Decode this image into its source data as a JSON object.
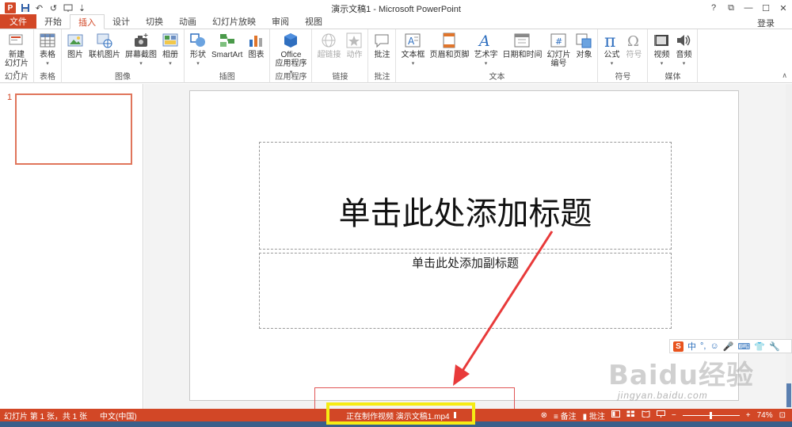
{
  "window": {
    "title": "演示文稿1 - Microsoft PowerPoint",
    "help": "?",
    "restore": "⧉",
    "minimize": "—",
    "maximize": "☐",
    "close": "✕"
  },
  "qat": {
    "logo": "P",
    "save": "💾",
    "undo": "↶",
    "redo": "↺",
    "present": "🖵",
    "more": "⇣"
  },
  "tabs": [
    "文件",
    "开始",
    "插入",
    "设计",
    "切换",
    "动画",
    "幻灯片放映",
    "审阅",
    "视图"
  ],
  "active_tab": "插入",
  "login": "登录",
  "ribbon": {
    "groups": [
      {
        "label": "幻灯片",
        "buttons": [
          {
            "label": "新建\n幻灯片",
            "drop": "▾",
            "icon": "new-slide-icon"
          }
        ]
      },
      {
        "label": "表格",
        "buttons": [
          {
            "label": "表格",
            "drop": "▾",
            "icon": "table-icon"
          }
        ]
      },
      {
        "label": "图像",
        "buttons": [
          {
            "label": "图片",
            "icon": "picture-icon"
          },
          {
            "label": "联机图片",
            "icon": "online-picture-icon"
          },
          {
            "label": "屏幕截图",
            "drop": "▾",
            "icon": "screenshot-icon"
          },
          {
            "label": "相册",
            "drop": "▾",
            "icon": "album-icon"
          }
        ]
      },
      {
        "label": "插图",
        "buttons": [
          {
            "label": "形状",
            "drop": "▾",
            "icon": "shapes-icon"
          },
          {
            "label": "SmartArt",
            "icon": "smartart-icon"
          },
          {
            "label": "图表",
            "icon": "chart-icon"
          }
        ]
      },
      {
        "label": "应用程序",
        "buttons": [
          {
            "label": "Office\n应用程序",
            "drop": "▾",
            "icon": "office-apps-icon"
          }
        ]
      },
      {
        "label": "链接",
        "buttons": [
          {
            "label": "超链接",
            "icon": "hyperlink-icon",
            "disabled": true
          },
          {
            "label": "动作",
            "icon": "action-icon",
            "disabled": true
          }
        ]
      },
      {
        "label": "批注",
        "buttons": [
          {
            "label": "批注",
            "icon": "comment-icon"
          }
        ]
      },
      {
        "label": "文本",
        "buttons": [
          {
            "label": "文本框",
            "drop": "▾",
            "icon": "textbox-icon"
          },
          {
            "label": "页眉和页脚",
            "icon": "header-footer-icon"
          },
          {
            "label": "艺术字",
            "drop": "▾",
            "icon": "wordart-icon"
          },
          {
            "label": "日期和时间",
            "icon": "datetime-icon"
          },
          {
            "label": "幻灯片\n编号",
            "icon": "slide-number-icon"
          },
          {
            "label": "对象",
            "icon": "object-icon"
          }
        ]
      },
      {
        "label": "符号",
        "buttons": [
          {
            "label": "公式",
            "drop": "▾",
            "icon": "equation-icon"
          },
          {
            "label": "符号",
            "icon": "symbol-icon",
            "disabled": true
          }
        ]
      },
      {
        "label": "媒体",
        "buttons": [
          {
            "label": "视频",
            "drop": "▾",
            "icon": "video-icon"
          },
          {
            "label": "音频",
            "drop": "▾",
            "icon": "audio-icon"
          }
        ]
      }
    ],
    "collapse": "∧"
  },
  "thumbnail": {
    "number": "1"
  },
  "slide": {
    "title_placeholder": "单击此处添加标题",
    "subtitle_placeholder": "单击此处添加副标题"
  },
  "ime": {
    "logo": "S",
    "mode": "中",
    "punct": "°,",
    "emoji": "☺",
    "voice": "🎤",
    "keyboard": "⌨",
    "skin": "👕",
    "tools": "🔧"
  },
  "watermark": {
    "brand": "Baidu经验",
    "url": "jingyan.baidu.com"
  },
  "status": {
    "slide_info": "幻灯片 第 1 张，共 1 张",
    "language": "中文(中国)",
    "progress": "正在制作视频 演示文稿1.mp4",
    "cancel": "⊗",
    "notes": "备注",
    "comments": "批注",
    "zoom_minus": "−",
    "zoom_plus": "+",
    "zoom": "74%",
    "fit": "⊡"
  },
  "colors": {
    "accent": "#d24726",
    "highlight": "#f6ec14",
    "arrow": "#e83a3a"
  }
}
